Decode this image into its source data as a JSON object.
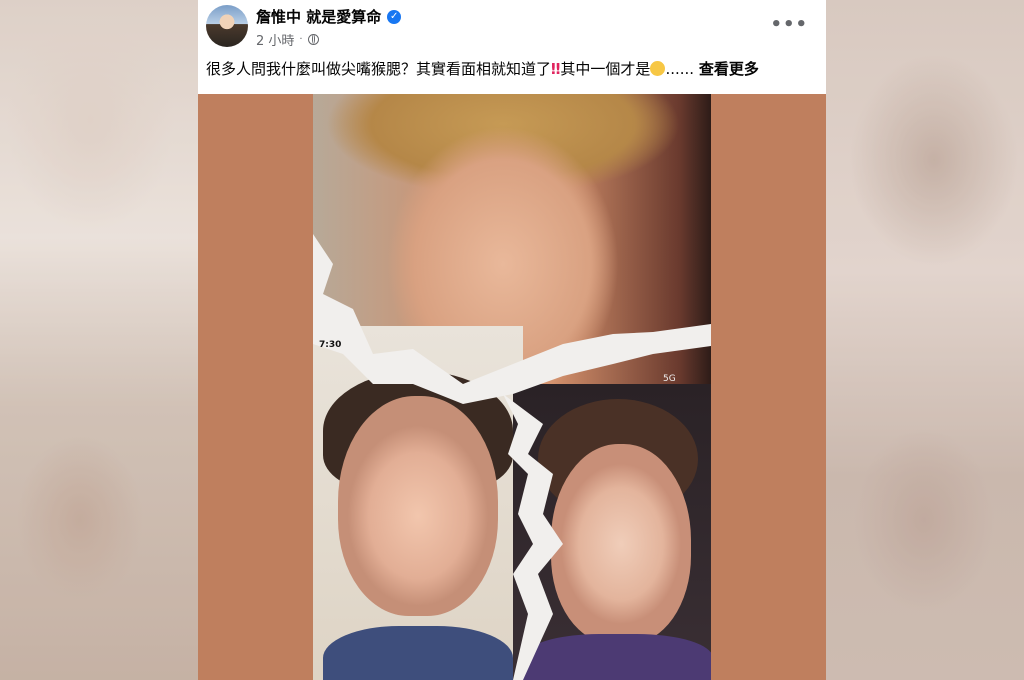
{
  "post": {
    "author": "詹惟中 就是愛算命",
    "time": "2 小時",
    "more_menu": "•••",
    "text_main": "很多人問我什麼叫做尖嘴猴腮？其實看面相就知道了",
    "text_mid": "其中一個才是",
    "text_ellipsis": "......",
    "see_more": "查看更多"
  },
  "icons": [
    "verified-badge-icon",
    "globe-icon",
    "more-options-icon",
    "double-exclamation-icon",
    "rofl-emoji-icon"
  ],
  "image": {
    "status_left": "7:30",
    "status_right": "5G"
  },
  "colors": {
    "image_bg": "#bf7f5e",
    "verified": "#1877f2",
    "secondary_text": "#65676b"
  }
}
